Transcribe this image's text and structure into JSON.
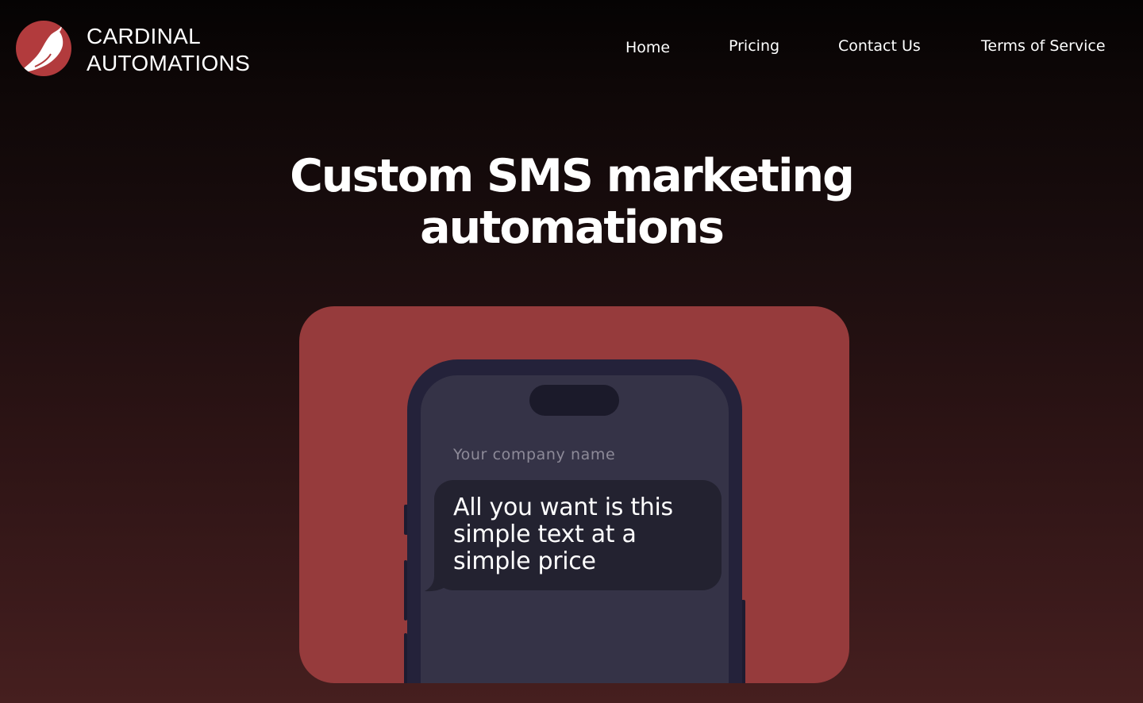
{
  "brand": {
    "line1": "CARDINAL",
    "line2": "AUTOMATIONS",
    "logo_icon": "cardinal-bird-icon",
    "logo_color": "#b23b3d"
  },
  "nav": {
    "home": "Home",
    "pricing": "Pricing",
    "contact": "Contact Us",
    "terms": "Terms of Service"
  },
  "hero": {
    "title": "Custom SMS marketing automations"
  },
  "phone": {
    "company_name": "Your company name",
    "message": "All you want is this simple text at a simple price"
  },
  "colors": {
    "card": "#963b3c",
    "phone_frame": "#24223a",
    "phone_screen": "#353347",
    "bubble": "#232230"
  }
}
